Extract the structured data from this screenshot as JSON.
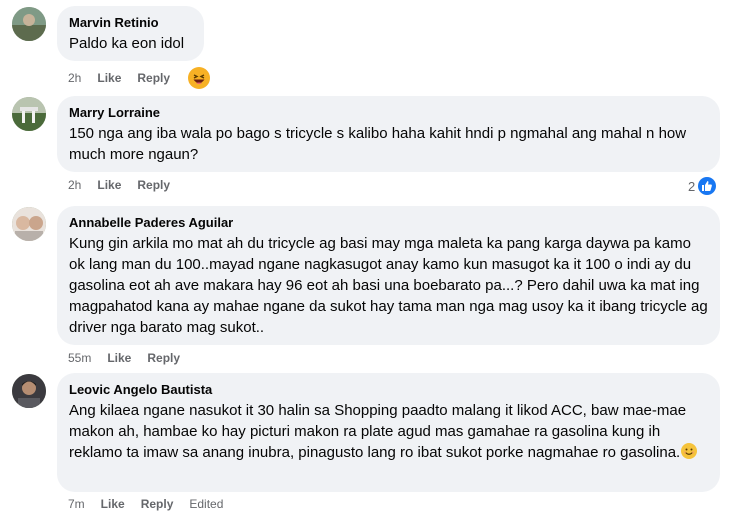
{
  "comments": [
    {
      "author": "Marvin Retinio",
      "text": "Paldo ka eon idol",
      "time": "2h",
      "like_label": "Like",
      "reply_label": "Reply",
      "reaction": "laugh-emoji-icon"
    },
    {
      "author": "Marry Lorraine",
      "text": "150 nga ang iba wala po bago s tricycle s kalibo haha kahit hndi p ngmahal ang mahal n how much more ngaun?",
      "time": "2h",
      "like_label": "Like",
      "reply_label": "Reply",
      "like_count": "2"
    },
    {
      "author": "Annabelle Paderes Aguilar",
      "text": "Kung gin arkila mo mat ah du tricycle ag basi may mga maleta ka pang karga daywa pa kamo ok lang man du 100..mayad ngane nagkasugot anay kamo kun masugot ka it 100 o indi ay du gasolina eot ah ave makara hay 96 eot ah basi una boebarato pa...? Pero dahil uwa ka mat ing magpahatod kana ay mahae ngane da sukot hay tama man nga mag usoy ka it ibang tricycle ag driver nga barato mag sukot..",
      "time": "55m",
      "like_label": "Like",
      "reply_label": "Reply"
    },
    {
      "author": "Leovic Angelo Bautista",
      "text": "Ang kilaea ngane nasukot it 30 halin sa Shopping paadto malang it likod ACC, baw mae-mae makon ah, hambae ko hay picturi makon ra plate agud mas gamahae ra gasolina kung ih reklamo ta imaw sa anang inubra, pinagusto lang ro ibat sukot porke nagmahae ro gasolina.",
      "time": "7m",
      "like_label": "Like",
      "reply_label": "Reply",
      "edited_label": "Edited"
    }
  ],
  "colors": {
    "bubble": "#f0f2f5",
    "meta_text": "#65676b",
    "like_blue": "#1877f2"
  }
}
